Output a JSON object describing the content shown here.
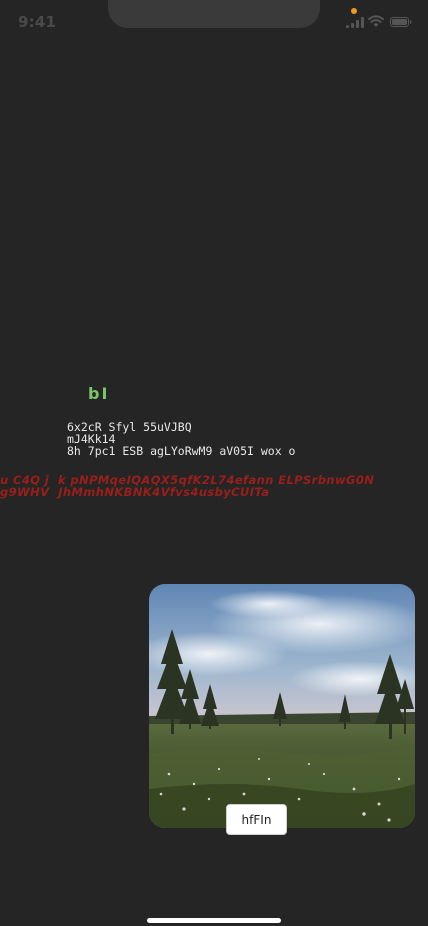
{
  "status_bar": {
    "time": "9:41"
  },
  "content": {
    "short_label": "bI",
    "mono_lines": [
      "6x2cR Sfyl 55uVJBQ",
      "mJ4Kk14",
      "8h 7pc1 ESB agLYoRwM9 aV05I wox o"
    ],
    "red_lines": [
      "u C4Q j  k pNPMqeIQAQX5qfK2L74efann ELPSrbnwG0N",
      "g9WHV  JhMmhNKBNK4Vfvs4usbyCUITa"
    ]
  },
  "photo": {
    "button_label": "hfFIn"
  },
  "colors": {
    "background": "#252525",
    "accent_green": "#7bc66a",
    "accent_red": "#9a1f1a",
    "privacy_dot": "#f39a1c"
  },
  "icons": [
    "cellular-signal-icon",
    "wifi-icon",
    "battery-icon"
  ]
}
